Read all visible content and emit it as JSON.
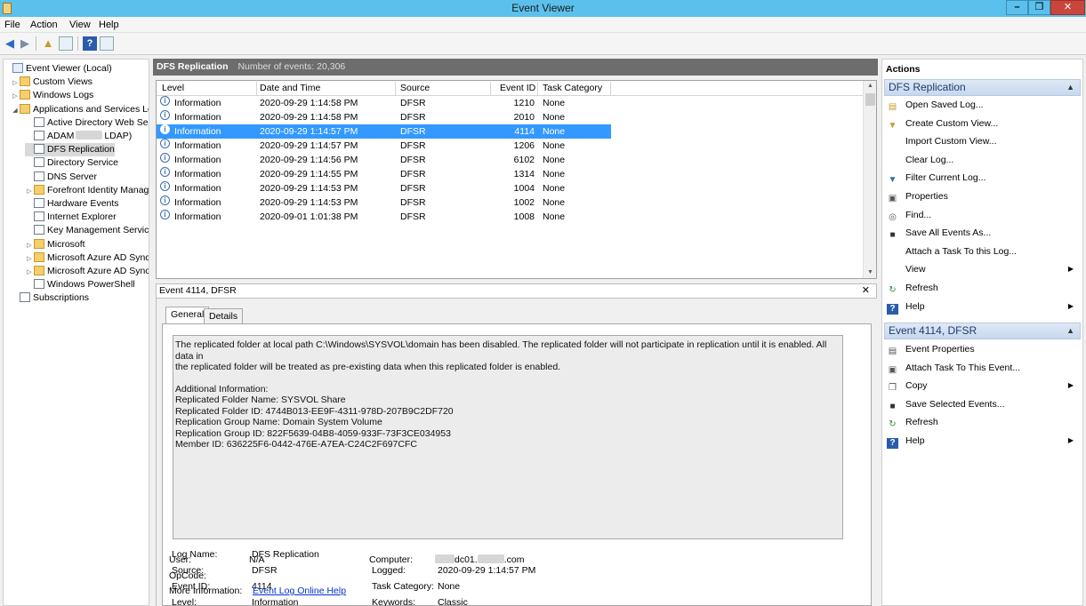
{
  "window": {
    "title": "Event Viewer",
    "min": "–",
    "max": "❐",
    "close": "✕"
  },
  "menu": [
    "File",
    "Action",
    "View",
    "Help"
  ],
  "tree": [
    {
      "label": "Event Viewer (Local)",
      "twisty": "",
      "icon": "ev"
    },
    {
      "label": "Custom Views",
      "twisty": "▷",
      "icon": "folder"
    },
    {
      "label": "Windows Logs",
      "twisty": "▷",
      "icon": "folder"
    },
    {
      "label": "Applications and Services Lo",
      "twisty": "◢",
      "icon": "folder"
    },
    {
      "label": "Active Directory Web Ser",
      "twisty": "",
      "icon": "log"
    },
    {
      "label": "ADAM",
      "label2": "LDAP)",
      "twisty": "",
      "icon": "log",
      "redacted": true
    },
    {
      "label": "DFS Replication",
      "twisty": "",
      "icon": "log",
      "selected": true
    },
    {
      "label": "Directory Service",
      "twisty": "",
      "icon": "log"
    },
    {
      "label": "DNS Server",
      "twisty": "",
      "icon": "log"
    },
    {
      "label": "Forefront Identity Manag",
      "twisty": "▷",
      "icon": "folder"
    },
    {
      "label": "Hardware Events",
      "twisty": "",
      "icon": "log"
    },
    {
      "label": "Internet Explorer",
      "twisty": "",
      "icon": "log"
    },
    {
      "label": "Key Management Service",
      "twisty": "",
      "icon": "log"
    },
    {
      "label": "Microsoft",
      "twisty": "▷",
      "icon": "folder"
    },
    {
      "label": "Microsoft Azure AD Sync",
      "twisty": "▷",
      "icon": "folder"
    },
    {
      "label": "Microsoft Azure AD Sync",
      "twisty": "▷",
      "icon": "folder"
    },
    {
      "label": "Windows PowerShell",
      "twisty": "",
      "icon": "log"
    },
    {
      "label": "Subscriptions",
      "twisty": "",
      "icon": "log"
    }
  ],
  "center": {
    "log_name": "DFS Replication",
    "count_text": "Number of events: 20,306"
  },
  "columns": [
    "Level",
    "Date and Time",
    "Source",
    "Event ID",
    "Task Category"
  ],
  "events": [
    {
      "level": "Information",
      "date": "2020-09-29 1:14:58 PM",
      "source": "DFSR",
      "id": "1210",
      "cat": "None"
    },
    {
      "level": "Information",
      "date": "2020-09-29 1:14:58 PM",
      "source": "DFSR",
      "id": "2010",
      "cat": "None"
    },
    {
      "level": "Information",
      "date": "2020-09-29 1:14:57 PM",
      "source": "DFSR",
      "id": "4114",
      "cat": "None",
      "selected": true
    },
    {
      "level": "Information",
      "date": "2020-09-29 1:14:57 PM",
      "source": "DFSR",
      "id": "1206",
      "cat": "None"
    },
    {
      "level": "Information",
      "date": "2020-09-29 1:14:56 PM",
      "source": "DFSR",
      "id": "6102",
      "cat": "None"
    },
    {
      "level": "Information",
      "date": "2020-09-29 1:14:55 PM",
      "source": "DFSR",
      "id": "1314",
      "cat": "None"
    },
    {
      "level": "Information",
      "date": "2020-09-29 1:14:53 PM",
      "source": "DFSR",
      "id": "1004",
      "cat": "None"
    },
    {
      "level": "Information",
      "date": "2020-09-29 1:14:53 PM",
      "source": "DFSR",
      "id": "1002",
      "cat": "None"
    },
    {
      "level": "Information",
      "date": "2020-09-01 1:01:38 PM",
      "source": "DFSR",
      "id": "1008",
      "cat": "None"
    }
  ],
  "detail": {
    "header": "Event 4114, DFSR",
    "close": "✕",
    "tabs": [
      "General",
      "Details"
    ],
    "message_line1": "The replicated folder at local path C:\\Windows\\SYSVOL\\domain has been disabled. The replicated folder will not participate in replication until it is enabled. All data in",
    "message_line2": "the replicated folder will be treated as pre-existing data when this replicated folder is enabled.",
    "additional": [
      "Additional Information:",
      "Replicated Folder Name: SYSVOL Share",
      "Replicated Folder ID: 4744B013-EE9F-4311-978D-207B9C2DF720",
      "Replication Group Name: Domain System Volume",
      "Replication Group ID: 822F5639-04B8-4059-933F-73F3CE034953",
      "Member ID: 636225F6-0442-476E-A7EA-C24C2F697CFC"
    ],
    "labels": {
      "log_name": "Log Name:",
      "source": "Source:",
      "event_id": "Event ID:",
      "level": "Level:",
      "user": "User:",
      "opcode": "OpCode:",
      "more_info": "More Information:",
      "logged": "Logged:",
      "task_category": "Task Category:",
      "keywords": "Keywords:",
      "computer": "Computer:"
    },
    "values": {
      "log_name": "DFS Replication",
      "source": "DFSR",
      "event_id": "4114",
      "level": "Information",
      "user": "N/A",
      "opcode": "",
      "more_info": "Event Log Online Help",
      "logged": "2020-09-29 1:14:57 PM",
      "task_category": "None",
      "keywords": "Classic",
      "computer_a": "dc01.",
      "computer_b": ".com"
    }
  },
  "actions": {
    "title": "Actions",
    "section1": "DFS Replication",
    "items1": [
      {
        "label": "Open Saved Log...",
        "icon": "▤",
        "color": "#c79a2a"
      },
      {
        "label": "Create Custom View...",
        "icon": "▼",
        "color": "#c79a2a"
      },
      {
        "label": "Import Custom View...",
        "icon": "",
        "color": "#000"
      },
      {
        "label": "Clear Log...",
        "icon": "",
        "color": "#000"
      },
      {
        "label": "Filter Current Log...",
        "icon": "▼",
        "color": "#3b6bb0"
      },
      {
        "label": "Properties",
        "icon": "▣",
        "color": "#555"
      },
      {
        "label": "Find...",
        "icon": "◎",
        "color": "#555"
      },
      {
        "label": "Save All Events As...",
        "icon": "■",
        "color": "#333"
      },
      {
        "label": "Attach a Task To this Log...",
        "icon": "",
        "color": "#000"
      },
      {
        "label": "View",
        "icon": "",
        "color": "#000",
        "sub": true
      },
      {
        "label": "Refresh",
        "icon": "↻",
        "color": "#2c8a3c"
      },
      {
        "label": "Help",
        "icon": "?",
        "color": "#fff",
        "bg": "#2a5caa",
        "sub": true
      }
    ],
    "section2": "Event 4114, DFSR",
    "items2": [
      {
        "label": "Event Properties",
        "icon": "▤",
        "color": "#555"
      },
      {
        "label": "Attach Task To This Event...",
        "icon": "▣",
        "color": "#555"
      },
      {
        "label": "Copy",
        "icon": "❐",
        "color": "#555",
        "sub": true
      },
      {
        "label": "Save Selected Events...",
        "icon": "■",
        "color": "#333"
      },
      {
        "label": "Refresh",
        "icon": "↻",
        "color": "#2c8a3c"
      },
      {
        "label": "Help",
        "icon": "?",
        "color": "#fff",
        "bg": "#2a5caa",
        "sub": true
      }
    ]
  }
}
